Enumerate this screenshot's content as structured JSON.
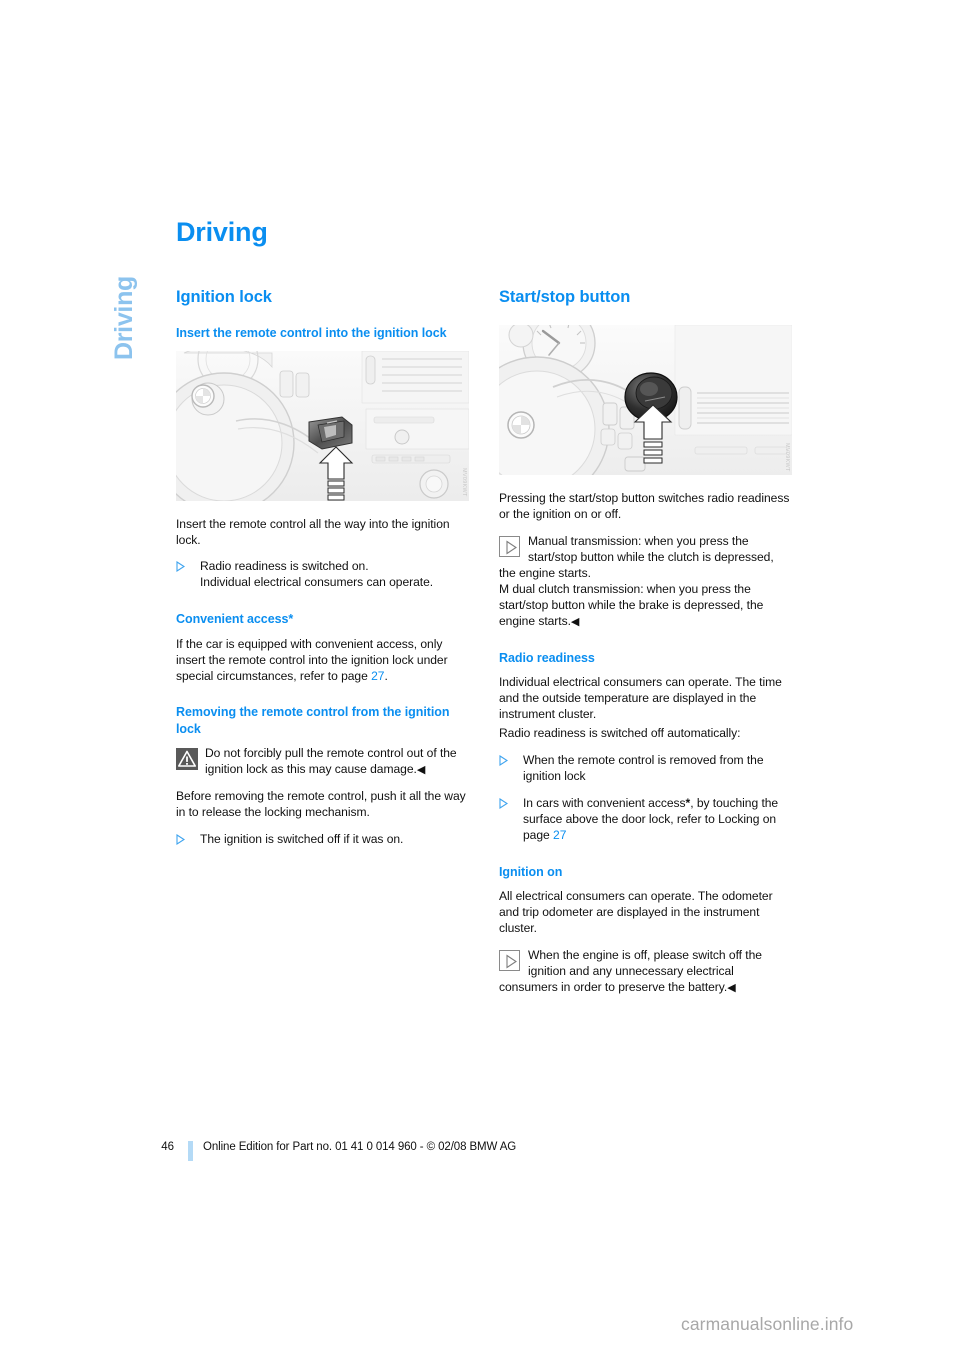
{
  "chapter_tab": "Driving",
  "doc_title": "Driving",
  "colors": {
    "heading_blue": "#0a8ef0",
    "tab_blue": "#8cc3ee",
    "folio_rule_blue": "#b4daf6",
    "warning_icon_bg": "#595959",
    "watermark_gray": "#a8a8a8"
  },
  "left_column": {
    "section_title": "Ignition lock",
    "sub1_title": "Insert the remote control into the ignition lock",
    "figure1": {
      "alt": "BMW steering wheel and dashboard with remote control inserted into the ignition lock, white arrow pointing at the lock",
      "code": "MV09KWT"
    },
    "p1": "Insert the remote control all the way into the ignition lock.",
    "bullet1_line1": "Radio readiness is switched on.",
    "bullet1_line2": "Individual electrical consumers can operate.",
    "sub2_title": "Convenient access*",
    "p2_before": "If the car is equipped with convenient access, only insert the remote control into the ignition lock under special circumstances, refer to page ",
    "p2_pageref": "27",
    "p2_after": ".",
    "sub3_title": "Removing the remote control from the ignition lock",
    "warning_text": "Do not forcibly pull the remote control out of the ignition lock as this may cause damage.",
    "warning_endmark": "◀",
    "p3": "Before removing the remote control, push it all the way in to release the locking mechanism.",
    "bullet2": "The ignition is switched off if it was on."
  },
  "right_column": {
    "section_title": "Start/stop button",
    "figure2": {
      "alt": "BMW steering wheel and dashboard showing the start/stop button, white arrow pointing at the button",
      "code": "MV09KWT"
    },
    "p1": "Pressing the start/stop button switches radio readiness or the ignition on or off.",
    "note1_text": "Manual transmission: when you press the start/stop button while the clutch is depressed, the engine starts.",
    "note1_text2": "M dual clutch transmission: when you press the start/stop button while the brake is depressed, the engine starts.",
    "note1_endmark": "◀",
    "sub1_title": "Radio readiness",
    "p2": "Individual electrical consumers can operate. The time and the outside temperature are displayed in the instrument cluster.",
    "p3": "Radio readiness is switched off automatically:",
    "bullet1": "When the remote control is removed from the ignition lock",
    "bullet2_before": "In cars with convenient access",
    "bullet2_star": "*",
    "bullet2_mid": ", by touching the surface above the door lock, refer to Locking on page ",
    "bullet2_pageref": "27",
    "sub2_title": "Ignition on",
    "p4": "All electrical consumers can operate. The odometer and trip odometer are displayed in the instrument cluster.",
    "note2_text": "When the engine is off, please switch off the ignition and any unnecessary electrical consumers in order to preserve the battery.",
    "note2_endmark": "◀"
  },
  "footer": {
    "page_number": "46",
    "edition": "Online Edition for Part no. 01 41 0 014 960 - © 02/08 BMW AG"
  },
  "watermark": "carmanualsonline.info"
}
